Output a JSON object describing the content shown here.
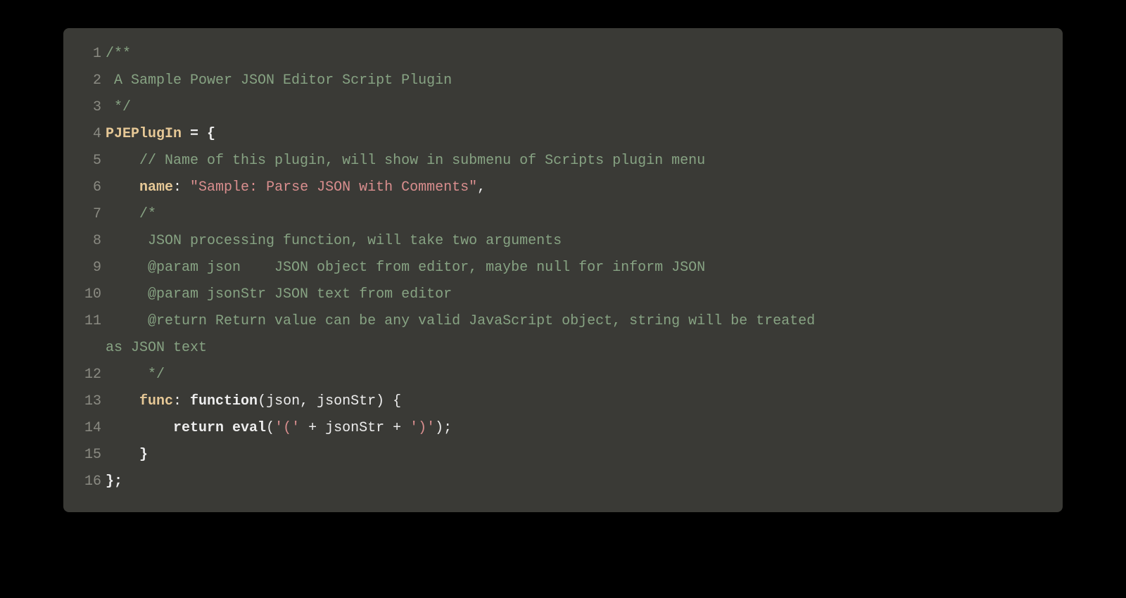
{
  "lines": {
    "l1": {
      "num": "1",
      "comment": "/**"
    },
    "l2": {
      "num": "2",
      "comment": " A Sample Power JSON Editor Script Plugin"
    },
    "l3": {
      "num": "3",
      "comment": " */"
    },
    "l4": {
      "num": "4",
      "ident": "PJEPlugIn",
      "assign": " = {"
    },
    "l5": {
      "num": "5",
      "comment": "    // Name of this plugin, will show in submenu of Scripts plugin menu"
    },
    "l6": {
      "num": "6",
      "indent": "    ",
      "key": "name",
      "colon": ": ",
      "string": "\"Sample: Parse JSON with Comments\"",
      "comma": ","
    },
    "l7": {
      "num": "7",
      "comment": "    /*"
    },
    "l8": {
      "num": "8",
      "comment": "     JSON processing function, will take two arguments"
    },
    "l9": {
      "num": "9",
      "comment": "     @param json    JSON object from editor, maybe null for inform JSON"
    },
    "l10": {
      "num": "10",
      "comment": "     @param jsonStr JSON text from editor"
    },
    "l11": {
      "num": "11",
      "comment": "     @return Return value can be any valid JavaScript object, string will be treated",
      "cont": " as JSON text"
    },
    "l12": {
      "num": "12",
      "comment": "     */"
    },
    "l13": {
      "num": "13",
      "indent": "    ",
      "key": "func",
      "colon": ": ",
      "kw": "function",
      "params": "(json, jsonStr) {"
    },
    "l14": {
      "num": "14",
      "indent": "        ",
      "kw1": "return ",
      "kw2": "eval",
      "paren_open": "(",
      "str1": "'('",
      "plus1": " + jsonStr + ",
      "str2": "')'",
      "paren_close": ");"
    },
    "l15": {
      "num": "15",
      "text": "    }"
    },
    "l16": {
      "num": "16",
      "text": "};"
    }
  }
}
